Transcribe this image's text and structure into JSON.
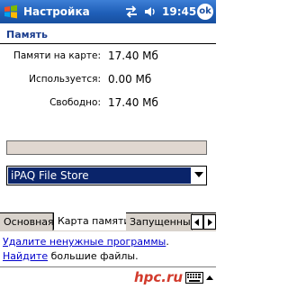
{
  "title_bar": {
    "title": "Настройка",
    "time": "19:45",
    "ok_label": "ok"
  },
  "section": {
    "title": "Память"
  },
  "storage_info": [
    {
      "label": "Памяти на карте:",
      "value": "17.40 Мб"
    },
    {
      "label": "Используется:",
      "value": "0.00 Мб"
    },
    {
      "label": "Свободно:",
      "value": "17.40 Мб"
    }
  ],
  "usage_bar": {
    "fill_fraction": 0
  },
  "storage_select": {
    "value": "iPAQ File Store"
  },
  "tabs": [
    {
      "label": "Основная"
    },
    {
      "label": "Карта памяти"
    },
    {
      "label": "Запущенные"
    }
  ],
  "links": {
    "line1_link": "Удалите ненужные программы",
    "line1_suffix": ".",
    "line2_link": "Найдите",
    "line2_suffix": " большие файлы."
  },
  "bottom_bar": {
    "watermark": "hpc.ru"
  },
  "colors": {
    "title_bar": "#1f5fb8",
    "selection": "#0a246a",
    "link": "#0000cc",
    "watermark": "#d23b2d"
  }
}
